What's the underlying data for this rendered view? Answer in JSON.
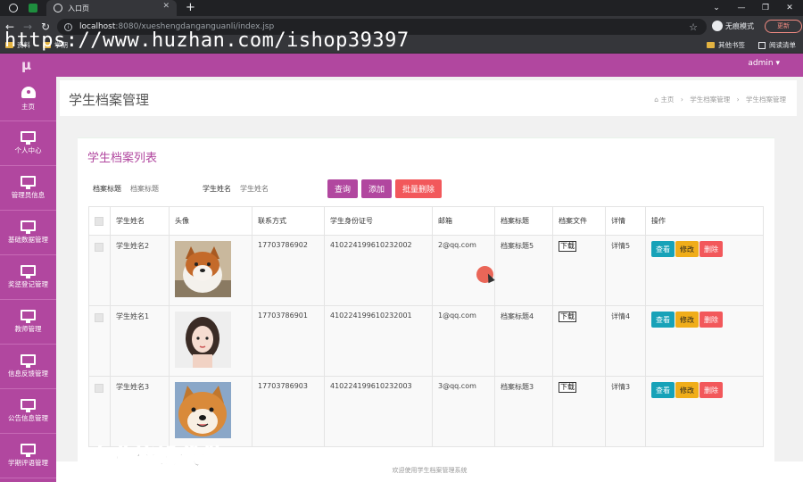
{
  "browser": {
    "tab_title": "入口页",
    "url_host": "localhost",
    "url_path": ":8080/xueshengdanganguanli/index.jsp",
    "incognito_label": "无痕模式",
    "update_label": "更新",
    "bookmarks": [
      "资料",
      "学期",
      "其他书签",
      "阅读清单"
    ],
    "watermark": "https://www.huzhan.com/ishop39397"
  },
  "header": {
    "logo": "μ",
    "user": "admin ▾"
  },
  "sidebar": {
    "items": [
      {
        "label": "主页",
        "icon": "dashboard-icon"
      },
      {
        "label": "个人中心",
        "icon": "monitor-icon"
      },
      {
        "label": "管理员信息",
        "icon": "monitor-icon"
      },
      {
        "label": "基础数据管理",
        "icon": "monitor-icon"
      },
      {
        "label": "奖惩登记管理",
        "icon": "monitor-icon"
      },
      {
        "label": "教师管理",
        "icon": "monitor-icon"
      },
      {
        "label": "信息反馈管理",
        "icon": "monitor-icon"
      },
      {
        "label": "公告信息管理",
        "icon": "monitor-icon"
      },
      {
        "label": "学期评语管理",
        "icon": "monitor-icon"
      }
    ]
  },
  "page": {
    "title": "学生档案管理",
    "breadcrumb": [
      "主页",
      "学生档案管理",
      "学生档案管理"
    ],
    "card_title": "学生档案列表",
    "search": {
      "label1": "档案标题",
      "placeholder1": "档案标题",
      "label2": "学生姓名",
      "placeholder2": "学生姓名",
      "query_btn": "查询",
      "add_btn": "添加",
      "batch_delete_btn": "批量删除"
    },
    "table": {
      "headers": [
        "学生姓名",
        "头像",
        "联系方式",
        "学生身份证号",
        "邮箱",
        "档案标题",
        "档案文件",
        "详情",
        "操作"
      ],
      "rows": [
        {
          "name": "学生姓名2",
          "avatar": "shiba-dog",
          "phone": "17703786902",
          "idcard": "410224199610232002",
          "email": "2@qq.com",
          "title": "档案标题5",
          "file": "下载",
          "detail": "详情5"
        },
        {
          "name": "学生姓名1",
          "avatar": "woman-portrait",
          "phone": "17703786901",
          "idcard": "410224199610232001",
          "email": "1@qq.com",
          "title": "档案标题4",
          "file": "下载",
          "detail": "详情4"
        },
        {
          "name": "学生姓名3",
          "avatar": "shiba-dog-2",
          "phone": "17703786903",
          "idcard": "410224199610232003",
          "email": "3@qq.com",
          "title": "档案标题3",
          "file": "下载",
          "detail": "详情3"
        }
      ],
      "actions": {
        "view": "查看",
        "edit": "修改",
        "delete": "删除"
      }
    },
    "footer": "欢迎使用学生档案管理系统",
    "overlay": "专业毕设代做"
  },
  "colors": {
    "brand": "#b1479f",
    "view": "#17a2b8",
    "edit": "#f0ad1a",
    "delete": "#f2585b"
  }
}
